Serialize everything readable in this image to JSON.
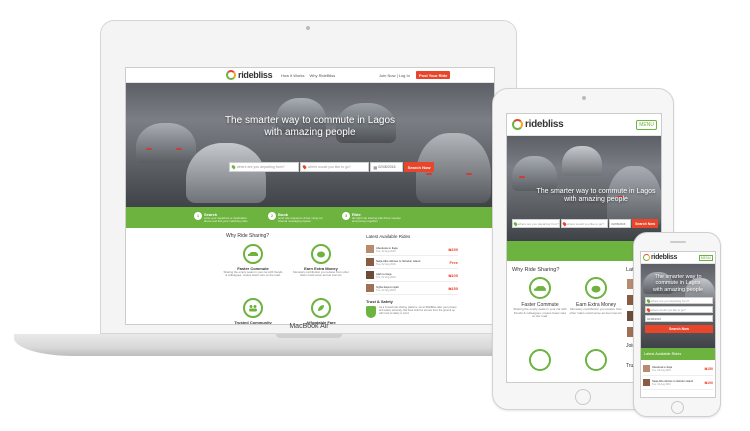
{
  "brand": {
    "name": "ridebliss",
    "sub": "Lagos",
    "colors": {
      "green": "#6db33f",
      "red": "#e8452b",
      "orange": "#f5a623"
    }
  },
  "laptop": {
    "nav": {
      "links": [
        "How it Works",
        "Why RideBliss"
      ],
      "login": "Join Now | Log In",
      "cta": "Post Your Ride"
    },
    "hero": {
      "title_line1": "The smarter way to commute in Lagos",
      "title_line2": "with amazing people"
    },
    "search": {
      "from_placeholder": "where are you departing from?",
      "to_placeholder": "where would you like to go?",
      "date": "02/08/2016",
      "button": "Search Now"
    },
    "steps": [
      {
        "num": "1",
        "title": "Search",
        "text": "enter your departure or destination above and find your matching rides"
      },
      {
        "num": "2",
        "title": "Book",
        "text": "send ride request to driver using our internal messaging system"
      },
      {
        "num": "3",
        "title": "Ride",
        "text": "all night ride sharing with driver meetup and journey together"
      }
    ],
    "why": {
      "title": "Why Ride Sharing?",
      "items": [
        {
          "icon": "car-icon",
          "title": "Faster Commute",
          "text": "Sharing the empty seats in your car with friends & colleagues, means fewer cars on the road."
        },
        {
          "icon": "piggy-bank-icon",
          "title": "Earn Extra Money",
          "text": "Monetary contribution you receive from other riders could serve as fuel cost etc."
        },
        {
          "icon": "people-icon",
          "title": "Trusted Community",
          "text": ""
        },
        {
          "icon": "leaf-icon",
          "title": "Affordable Fare",
          "text": ""
        }
      ]
    },
    "latest": {
      "title": "Latest Available Rides",
      "rides": [
        {
          "route": "Abeokuta to Ikeja",
          "date": "Tue, 02 Aug 2016",
          "price": "₦150",
          "seats": "2 seats left"
        },
        {
          "route": "Naija Alhe Akinwe to Ifelodun Island",
          "date": "Tue, 02 Aug 2016",
          "price": "Free",
          "seats": "2 seats left"
        },
        {
          "route": "Ajah to Ikeja",
          "date": "Tue, 02 Aug 2016",
          "price": "₦100",
          "seats": "2 seats left"
        },
        {
          "route": "Ogba Ikeja to Ajah",
          "date": "Tue, 02 Aug 2016",
          "price": "₦150",
          "seats": "2 seats left"
        }
      ]
    },
    "trust": {
      "title": "Trust & Safety",
      "text": "As a trusted ride sharing platform, we at RideBliss take your privacy and safety seriously. We have built the service from the ground up with trust & safety in mind."
    },
    "model": "MacBook Air"
  },
  "tablet": {
    "menu": "MENU",
    "hero": {
      "title_line1": "The smarter way to commute in Lagos",
      "title_line2": "with amazing people"
    },
    "search": {
      "from_placeholder": "where are you departing from?",
      "to_placeholder": "where would you like to go?",
      "date": "02/08/2016",
      "button": "Search Now"
    },
    "why_title": "Why Ride Sharing?",
    "latest_title": "Latest A",
    "items": [
      {
        "title": "Faster Commute",
        "text": "Sharing the empty seats in your car with friends & colleagues, means fewer cars on the road."
      },
      {
        "title": "Earn Extra Money",
        "text": "Monetary contribution you receive from other riders could serve as fuel cost etc."
      }
    ],
    "join": "Join Ride",
    "trust": "Trust &"
  },
  "phone": {
    "menu": "MENU",
    "hero": {
      "title_line1": "The smarter way to",
      "title_line2": "commute in Lagos",
      "title_line3": "with amazing people"
    },
    "search": {
      "from_placeholder": "where are you departing from?",
      "to_placeholder": "where would you like to go?",
      "date": "02/08/2016",
      "button": "Search Now"
    },
    "latest_title": "Latest Available Rides",
    "rides": [
      {
        "route": "Abeokuta to Ikeja",
        "date": "Tue, 02 Aug 2016",
        "price": "₦150"
      },
      {
        "route": "Naija Alhe Akinwe to Ifelodun Island",
        "date": "Tue, 02 Aug 2016",
        "price": "₦100"
      }
    ]
  }
}
